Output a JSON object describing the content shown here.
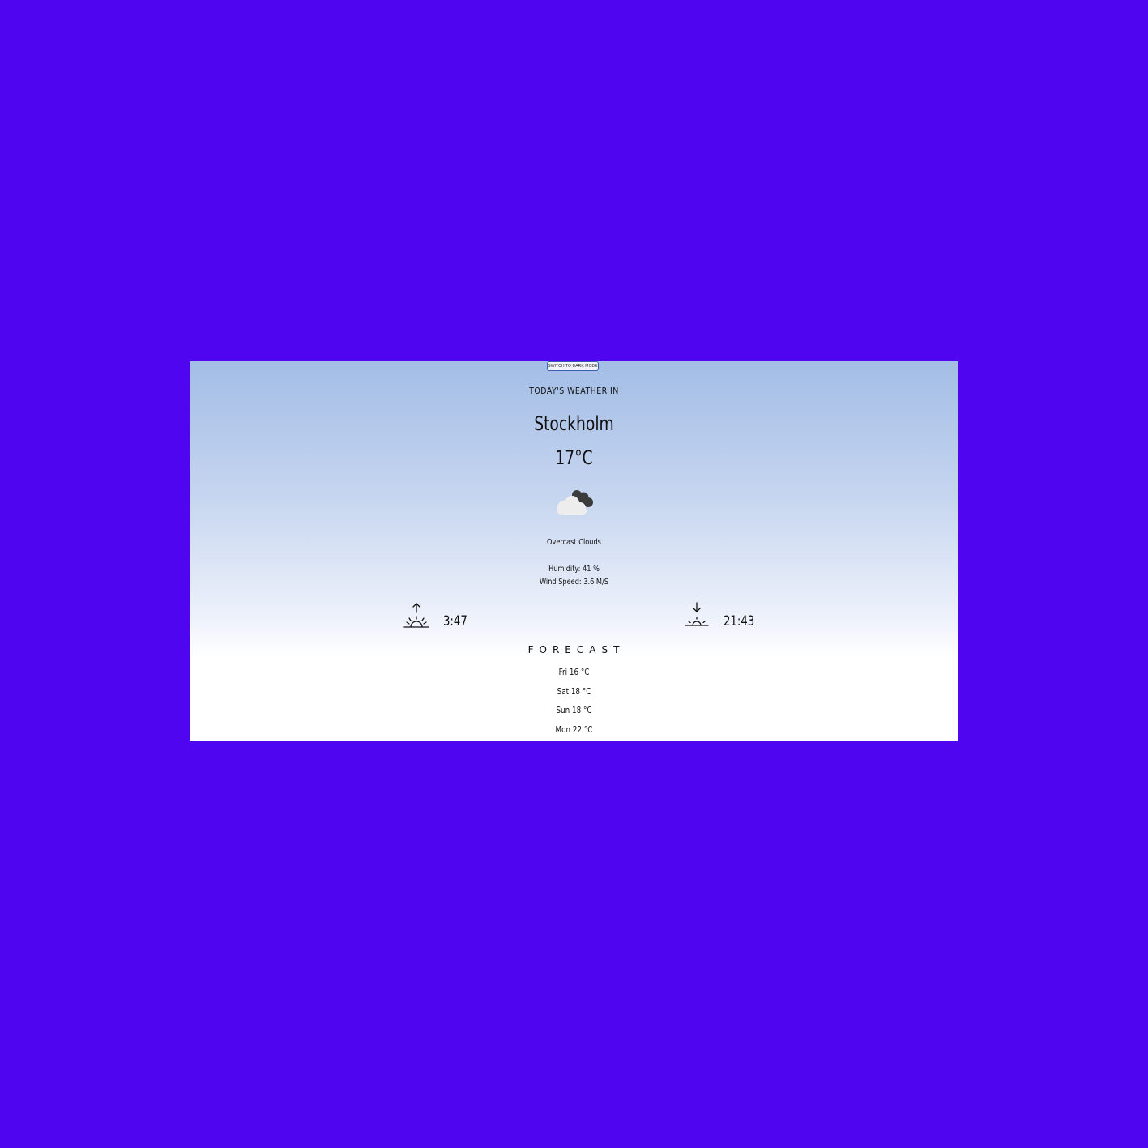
{
  "toggle": {
    "label": "SWITCH TO DARK MODE"
  },
  "heading": "TODAY'S WEATHER IN",
  "city": "Stockholm",
  "temperature": "17°C",
  "icon": "overcast-clouds-icon",
  "description": "Overcast Clouds",
  "humidity": "Humidity: 41 %",
  "wind_speed": "Wind Speed: 3.6 M/S",
  "sunrise": {
    "icon": "sunrise-icon",
    "time": "3:47"
  },
  "sunset": {
    "icon": "sunset-icon",
    "time": "21:43"
  },
  "forecast": {
    "title": "FORECAST",
    "days": [
      {
        "label": "Fri 16 °C"
      },
      {
        "label": "Sat 18 °C"
      },
      {
        "label": "Sun 18 °C"
      },
      {
        "label": "Mon 22 °C"
      }
    ]
  },
  "colors": {
    "page_background": "#4f05f0",
    "gradient_top": "#a3bde6",
    "gradient_bottom": "#ffffff"
  }
}
